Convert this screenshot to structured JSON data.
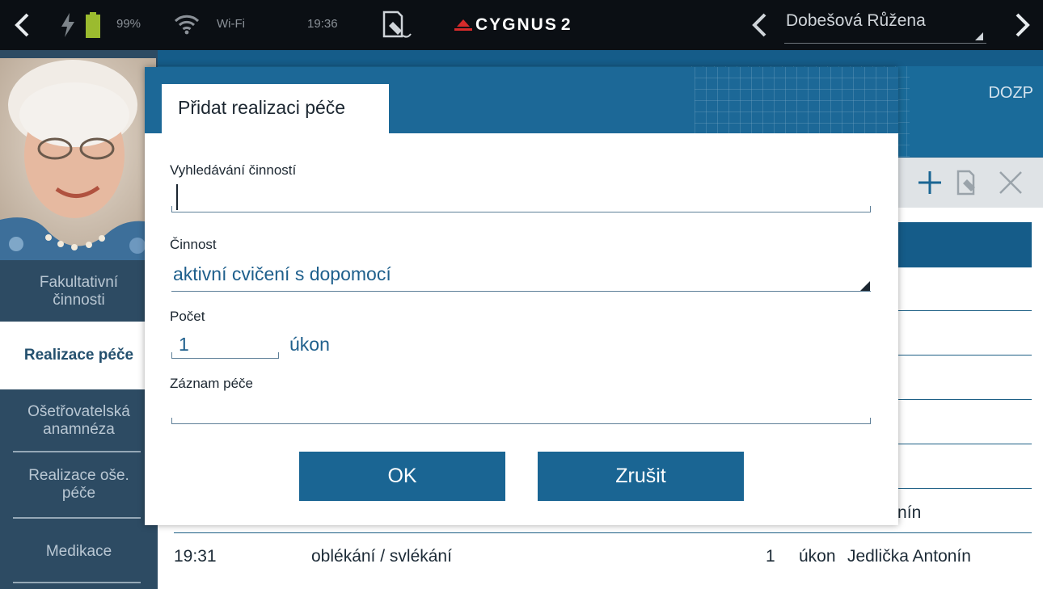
{
  "status_bar": {
    "battery_percent": "99%",
    "wifi_label": "Wi-Fi",
    "time": "19:36",
    "logo_text": "CYGNUS",
    "logo_suffix": "2",
    "resident_name": "Dobešová Růžena"
  },
  "sidebar": {
    "items": [
      {
        "label": "Fakultativní\nčinnosti",
        "active": false
      },
      {
        "label": "Realizace péče",
        "active": true
      },
      {
        "label": "Ošetřovatelská\nanamnéza",
        "active": false
      },
      {
        "label": "Realizace oše.\npéče",
        "active": false
      },
      {
        "label": "Medikace",
        "active": false
      }
    ]
  },
  "main": {
    "header_label": "DOZP",
    "rows": [
      {
        "time": "",
        "activity": "",
        "count": "",
        "unit": "",
        "staff": "ka Antonín"
      },
      {
        "time": "19:31",
        "activity": "oblékání / svlékání",
        "count": "1",
        "unit": "úkon",
        "staff": "Jedlička Antonín"
      }
    ]
  },
  "dialog": {
    "title": "Přidat realizaci péče",
    "search_label": "Vyhledávání činností",
    "search_value": "",
    "activity_label": "Činnost",
    "activity_value": "aktivní cvičení s dopomocí",
    "count_label": "Počet",
    "count_value": "1",
    "count_unit": "úkon",
    "note_label": "Záznam péče",
    "note_value": "",
    "ok_label": "OK",
    "cancel_label": "Zrušit"
  },
  "colors": {
    "accent": "#1a6593",
    "sidebar": "#2d4b63",
    "logo_red": "#d62b2b"
  },
  "icons": [
    "back-arrow-icon",
    "bolt-icon",
    "battery-icon",
    "wifi-icon",
    "sign-document-icon",
    "chevron-left-icon",
    "chevron-right-icon",
    "plus-icon",
    "edit-icon",
    "close-icon"
  ]
}
